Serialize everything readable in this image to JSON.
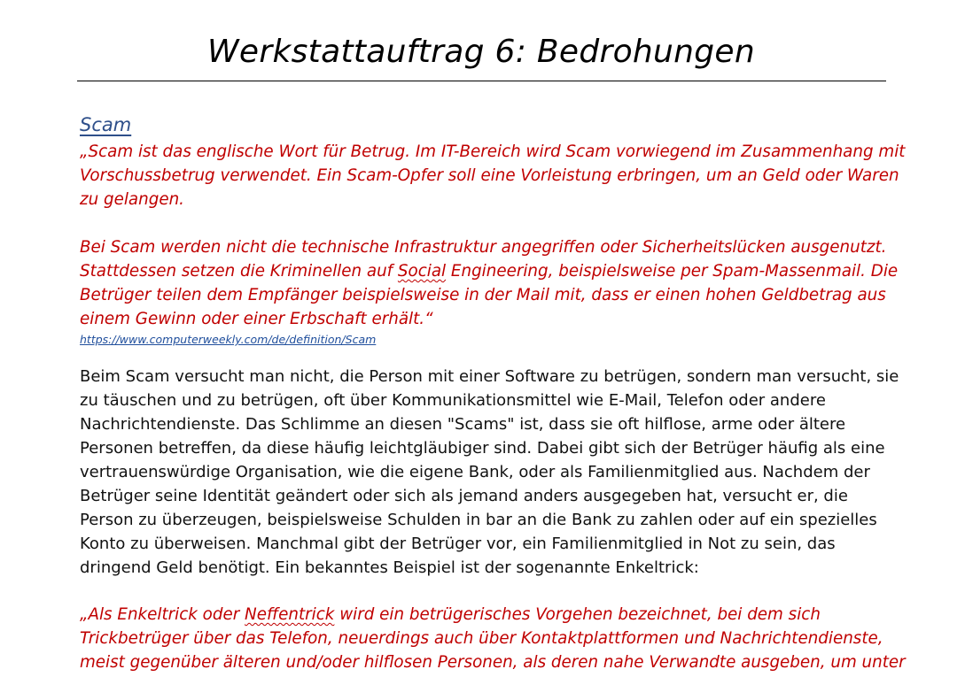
{
  "document": {
    "title": "Werkstattauftrag 6: Bedrohungen",
    "section_heading": "Scam",
    "quote_paragraph_1": [
      "„Scam ist das englische Wort für Betrug. Im IT-Bereich wird Scam vorwiegend im Zusammenhang mit",
      "Vorschussbetrug verwendet. Ein Scam-Opfer soll eine Vorleistung erbringen, um an Geld oder Waren",
      "zu gelangen."
    ],
    "quote_paragraph_2": {
      "line1": "Bei Scam werden nicht die technische Infrastruktur angegriffen oder Sicherheitslücken ausgenutzt.",
      "line2_before": "Stattdessen setzen die Kriminellen auf ",
      "line2_flagged": "Social",
      "line2_after": " Engineering, beispielsweise per Spam-Massenmail. Die",
      "line3": "Betrüger teilen dem Empfänger beispielsweise in der Mail mit, dass er einen hohen Geldbetrag aus",
      "line4": "einem Gewinn oder einer Erbschaft erhält.“"
    },
    "source_link": "https://www.computerweekly.com/de/definition/Scam",
    "body_paragraph": [
      "Beim Scam versucht man nicht, die Person mit einer Software zu betrügen, sondern man versucht, sie",
      "zu täuschen und zu betrügen, oft über Kommunikationsmittel wie E-Mail, Telefon oder andere",
      "Nachrichtendienste. Das Schlimme an diesen \"Scams\" ist, dass sie oft hilflose, arme oder ältere",
      "Personen betreffen, da diese häufig leichtgläubiger sind. Dabei gibt sich der Betrüger häufig als eine",
      "vertrauenswürdige Organisation, wie die eigene Bank, oder als Familienmitglied aus. Nachdem der",
      "Betrüger seine Identität geändert oder sich als jemand anders ausgegeben hat, versucht er, die",
      "Person zu überzeugen, beispielsweise Schulden in bar an die Bank zu zahlen oder auf ein spezielles",
      "Konto zu überweisen. Manchmal gibt der Betrüger vor, ein Familienmitglied in Not zu sein, das",
      "dringend Geld benötigt. Ein bekanntes Beispiel ist der sogenannte Enkeltrick:"
    ],
    "quote_paragraph_3": {
      "line1_before": "„Als Enkeltrick oder ",
      "line1_flagged": "Neffentrick",
      "line1_after": " wird ein betrügerisches Vorgehen bezeichnet, bei dem sich",
      "line2": "Trickbetrüger über das Telefon, neuerdings auch über Kontaktplattformen und Nachrichtendienste,",
      "line3": "meist gegenüber älteren und/oder hilflosen Personen, als deren nahe Verwandte ausgeben, um unter"
    }
  },
  "colors": {
    "quote_text": "#c00000",
    "heading": "#2e4f8a",
    "link": "#1f4e9c",
    "body_text": "#111111",
    "rule": "#000000"
  }
}
